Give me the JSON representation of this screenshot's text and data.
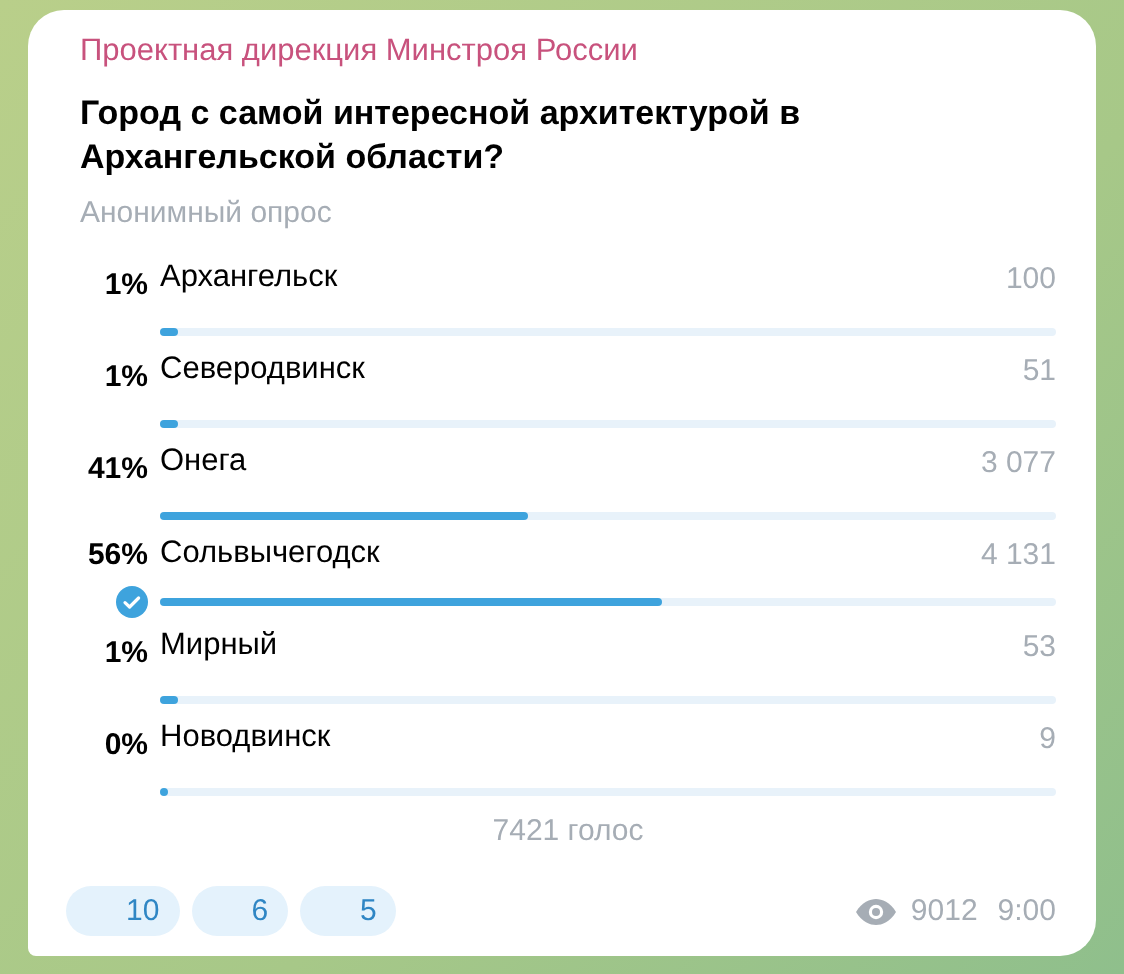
{
  "channel": {
    "name": "Проектная дирекция Минстроя России"
  },
  "poll": {
    "question": "Город с самой интересной архитектурой в Архангельской области?",
    "type": "Анонимный опрос",
    "options": [
      {
        "percent": "1%",
        "label": "Архангельск",
        "votes": "100",
        "level": 0.02,
        "selected": false
      },
      {
        "percent": "1%",
        "label": "Северодвинск",
        "votes": "51",
        "level": 0.02,
        "selected": false
      },
      {
        "percent": "41%",
        "label": "Онега",
        "votes": "3 077",
        "level": 0.41,
        "selected": false
      },
      {
        "percent": "56%",
        "label": "Сольвычегодск",
        "votes": "4 131",
        "level": 0.56,
        "selected": true
      },
      {
        "percent": "1%",
        "label": "Мирный",
        "votes": "53",
        "level": 0.02,
        "selected": false
      },
      {
        "percent": "0%",
        "label": "Новодвинск",
        "votes": "9",
        "level": 0.01,
        "selected": false
      }
    ],
    "total": "7421 голос"
  },
  "reactions": [
    {
      "count": "10"
    },
    {
      "count": "6"
    },
    {
      "count": "5"
    }
  ],
  "views": "9012",
  "time": "9:00"
}
